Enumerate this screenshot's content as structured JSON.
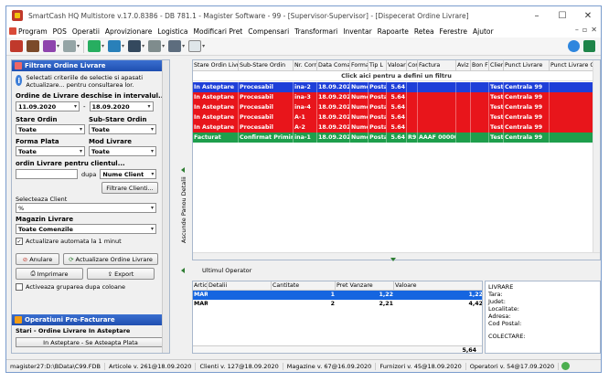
{
  "window": {
    "title": "SmartCash HQ Multistore v.17.0.8386 - DB 781.1 - Magister Software - 99 - [Supervisor-Supervisor] - [Dispecerat Ordine Livrare]",
    "controls": [
      "–",
      "☐",
      "✕"
    ]
  },
  "menu": {
    "items": [
      "Program",
      "POS",
      "Operatii",
      "Aprovizionare",
      "Logistica",
      "Modificari Pret",
      "Compensari",
      "Transformari",
      "Inventar",
      "Rapoarte",
      "Retea",
      "Ferestre",
      "Ajutor"
    ],
    "right_controls": [
      "–",
      "▫",
      "✕"
    ]
  },
  "left_panel": {
    "header": "Filtrare Ordine Livrare",
    "info": "Selectati criteriile de selectie si apasati Actualizare... pentru consultarea lor.",
    "date_label": "Ordine de Livrare deschise in intervalul...",
    "date_from": "11.09.2020",
    "date_to": "18.09.2020",
    "date_sep": "-",
    "stare_label": "Stare Ordin",
    "stare_value": "Toate",
    "substare_label": "Sub-Stare Ordin",
    "substare_value": "Toate",
    "forma_label": "Forma Plata",
    "forma_value": "Toate",
    "mod_label": "Mod Livrare",
    "mod_value": "Toate",
    "client_label": "ordin Livrare pentru clientul...",
    "client_value": "",
    "client_mid": "dupa",
    "client_mode": "Nume Client",
    "filter_clients": "Filtrare Clienti...",
    "select_client_label": "Selecteaza Client",
    "select_client_value": "%",
    "magazin_label": "Magazin Livrare",
    "magazin_value": "Toate Comenzile",
    "auto_refresh_label": "Actualizare automata la 1 minut",
    "auto_refresh_checked": true,
    "btn_cancel": "Anulare",
    "btn_refresh": "Actualizare Ordine Livrare",
    "btn_print": "Imprimare",
    "btn_export": "Export",
    "group_label": "Activeaza gruparea dupa coloane",
    "group_checked": false,
    "section2_header": "Operatiuni Pre-Facturare",
    "section2_label": "Stari - Ordine Livrare In Asteptare",
    "section2_button": "In Asteptare - Se Asteapta Plata"
  },
  "splitter_label": "Ascunde Panou Detalii",
  "grid": {
    "columns": [
      "Stare Ordin Livr",
      "Sub-Stare Ordin",
      "Nr. Corr",
      "Data Coma",
      "Forma",
      "Tip L",
      "Valoar",
      "Cor",
      "Factura",
      "Aviz",
      "Bon F",
      "Clier",
      "Punct Livrare",
      "Punct Livrare C"
    ],
    "filter_hint": "Click aici pentru a defini un filtru",
    "rows": [
      {
        "stare": "In Asteptare",
        "substare": "Procesabil",
        "nr": "ina-2",
        "data": "18.09.2020",
        "forma": "Nume",
        "tip": "Posta",
        "val": "5.64",
        "cor": "",
        "factura": "",
        "aviz": "",
        "bon": "",
        "client": "Test",
        "punct": "Centrala 99",
        "punctc": "",
        "color": "#1e3fd8"
      },
      {
        "stare": "In Asteptare",
        "substare": "Procesabil",
        "nr": "ina-3",
        "data": "18.09.2020",
        "forma": "Nume",
        "tip": "Posta",
        "val": "5.64",
        "cor": "",
        "factura": "",
        "aviz": "",
        "bon": "",
        "client": "Test",
        "punct": "Centrala 99",
        "punctc": "",
        "color": "#e8151b"
      },
      {
        "stare": "In Asteptare",
        "substare": "Procesabil",
        "nr": "ina-4",
        "data": "18.09.2020",
        "forma": "Nume",
        "tip": "Posta",
        "val": "5.64",
        "cor": "",
        "factura": "",
        "aviz": "",
        "bon": "",
        "client": "Test",
        "punct": "Centrala 99",
        "punctc": "",
        "color": "#e8151b"
      },
      {
        "stare": "In Asteptare",
        "substare": "Procesabil",
        "nr": "A-1",
        "data": "18.09.2020",
        "forma": "Nume",
        "tip": "Posta",
        "val": "5.64",
        "cor": "",
        "factura": "",
        "aviz": "",
        "bon": "",
        "client": "Test",
        "punct": "Centrala 99",
        "punctc": "",
        "color": "#e8151b"
      },
      {
        "stare": "In Asteptare",
        "substare": "Procesabil",
        "nr": "A-2",
        "data": "18.09.2020",
        "forma": "Nume",
        "tip": "Posta",
        "val": "5.64",
        "cor": "",
        "factura": "",
        "aviz": "",
        "bon": "",
        "client": "Test",
        "punct": "Centrala 99",
        "punctc": "",
        "color": "#e8151b"
      },
      {
        "stare": "Facturat",
        "substare": "Confirmat Primire",
        "nr": "ina-1",
        "data": "18.09.2020",
        "forma": "Nume",
        "tip": "Posta",
        "val": "5.64",
        "cor": "R9",
        "factura": "AAAF 00000",
        "aviz": "",
        "bon": "",
        "client": "Test",
        "punct": "Centrala 99",
        "punctc": "",
        "color": "#1e9e4c"
      }
    ]
  },
  "operator_label": "Ultimul Operator",
  "detail": {
    "columns": [
      "Artic",
      "Detalii",
      "Cantitate",
      "Pret Vanzare",
      "Valoare"
    ],
    "rows": [
      {
        "artic": "MAR",
        "detalii": "",
        "cant": "1",
        "pret": "1,22",
        "val": "1,22",
        "selected": true
      },
      {
        "artic": "MAR",
        "detalii": "",
        "cant": "2",
        "pret": "2,21",
        "val": "4,42",
        "selected": false
      }
    ],
    "total": "5,64"
  },
  "info_panel": {
    "lines": [
      "LIVRARE",
      "Tara:",
      "Judet:",
      "Localitate:",
      "Adresa:",
      "Cod Postal:",
      "",
      "COLECTARE:"
    ]
  },
  "status": {
    "items": [
      "magister27:D:\\BData\\C99.FDB",
      "Articole v. 261@18.09.2020",
      "Clienti v. 127@18.09.2020",
      "Magazine v. 67@16.09.2020",
      "Furnizori v. 45@18.09.2020",
      "Operatori v. 54@17.09.2020"
    ]
  },
  "colors": {
    "accent": "#1f4fb0",
    "row_blue": "#1e3fd8",
    "row_red": "#e8151b",
    "row_green": "#1e9e4c",
    "selected": "#1565e0"
  }
}
